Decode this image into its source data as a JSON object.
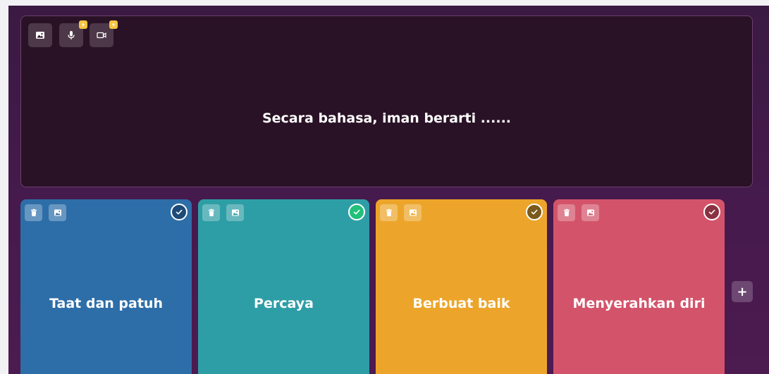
{
  "question": {
    "text": "Secara bahasa, iman berarti ......",
    "media_buttons": [
      {
        "icon": "image-icon",
        "premium": false
      },
      {
        "icon": "microphone-icon",
        "premium": true
      },
      {
        "icon": "video-icon",
        "premium": true
      }
    ]
  },
  "options": [
    {
      "text": "Taat dan patuh",
      "color": "#2d6ea8",
      "correct": false,
      "check_bg": "#1e4a78"
    },
    {
      "text": "Percaya",
      "color": "#2e9ea6",
      "correct": true,
      "check_bg": "#22c07a"
    },
    {
      "text": "Berbuat baik",
      "color": "#eca52a",
      "correct": false,
      "check_bg": "#7b5a1e"
    },
    {
      "text": "Menyerahkan diri",
      "color": "#d3546a",
      "correct": false,
      "check_bg": "#8a3242"
    }
  ],
  "add_option": {
    "label": "+"
  },
  "colors": {
    "panel_bg": "#2a1226",
    "editor_bg": "#461a4d",
    "badge": "#f5c542"
  }
}
